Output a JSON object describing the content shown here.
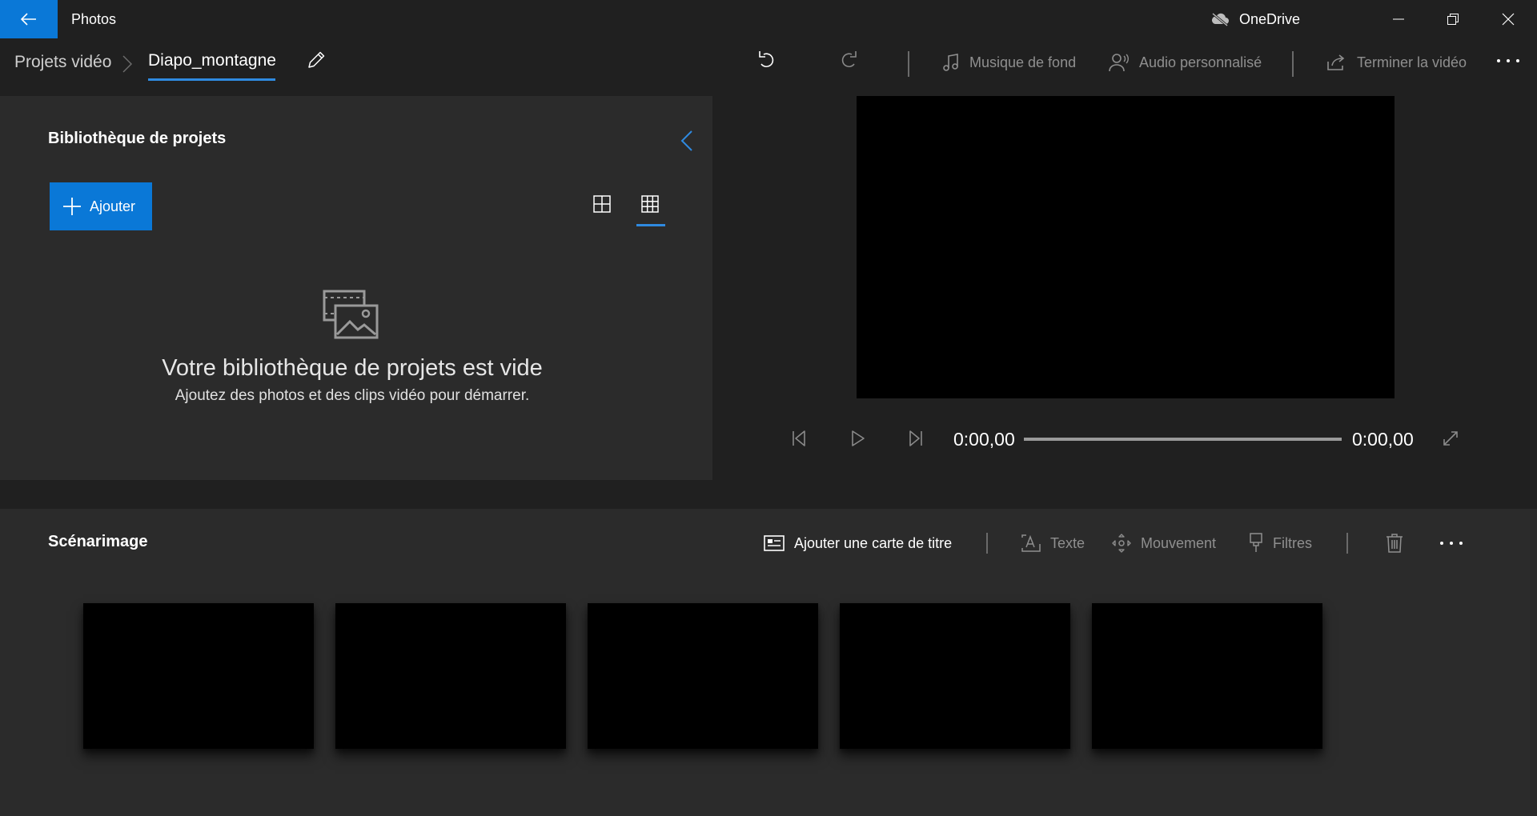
{
  "app": {
    "title": "Photos",
    "onedrive_label": "OneDrive"
  },
  "breadcrumb": {
    "root": "Projets vidéo",
    "current": "Diapo_montagne"
  },
  "toolbar": {
    "background_music": "Musique de fond",
    "custom_audio": "Audio personnalisé",
    "finish_video": "Terminer la vidéo"
  },
  "library": {
    "title": "Bibliothèque de projets",
    "add_label": "Ajouter",
    "empty_title": "Votre bibliothèque de projets est vide",
    "empty_subtitle": "Ajoutez des photos et des clips vidéo pour démarrer."
  },
  "player": {
    "current_time": "0:00,00",
    "total_time": "0:00,00",
    "progress": 0
  },
  "storyboard": {
    "title": "Scénarimage",
    "add_title_card": "Ajouter une carte de titre",
    "text": "Texte",
    "motion": "Mouvement",
    "filters": "Filtres",
    "clip_count": 5
  },
  "colors": {
    "accent": "#0a78d7",
    "background": "#202020",
    "panel": "#2b2b2b"
  }
}
